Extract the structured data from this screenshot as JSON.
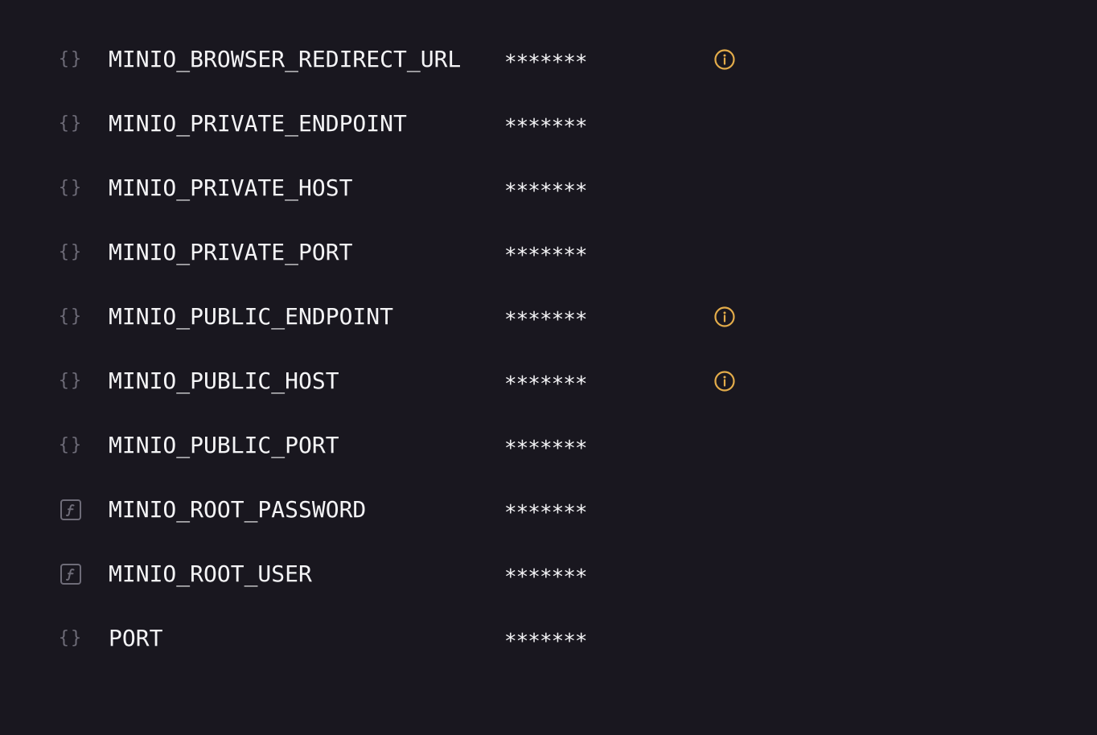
{
  "variables": [
    {
      "name": "MINIO_BROWSER_REDIRECT_URL",
      "value": "*******",
      "type_icon": "braces-icon",
      "info": true
    },
    {
      "name": "MINIO_PRIVATE_ENDPOINT",
      "value": "*******",
      "type_icon": "braces-icon",
      "info": false
    },
    {
      "name": "MINIO_PRIVATE_HOST",
      "value": "*******",
      "type_icon": "braces-icon",
      "info": false
    },
    {
      "name": "MINIO_PRIVATE_PORT",
      "value": "*******",
      "type_icon": "braces-icon",
      "info": false
    },
    {
      "name": "MINIO_PUBLIC_ENDPOINT",
      "value": "*******",
      "type_icon": "braces-icon",
      "info": true
    },
    {
      "name": "MINIO_PUBLIC_HOST",
      "value": "*******",
      "type_icon": "braces-icon",
      "info": true
    },
    {
      "name": "MINIO_PUBLIC_PORT",
      "value": "*******",
      "type_icon": "braces-icon",
      "info": false
    },
    {
      "name": "MINIO_ROOT_PASSWORD",
      "value": "*******",
      "type_icon": "function-icon",
      "info": false
    },
    {
      "name": "MINIO_ROOT_USER",
      "value": "*******",
      "type_icon": "function-icon",
      "info": false
    },
    {
      "name": "PORT",
      "value": "*******",
      "type_icon": "braces-icon",
      "info": false
    }
  ],
  "colors": {
    "background": "#19171f",
    "text": "#f4f4f6",
    "icon_muted": "#6e6c78",
    "info_accent": "#e3ac4a"
  }
}
